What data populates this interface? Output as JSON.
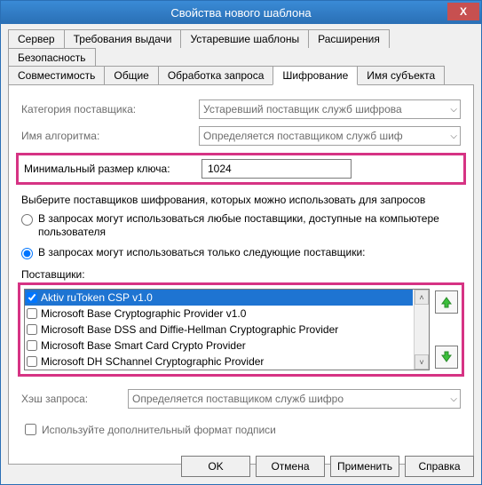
{
  "window": {
    "title": "Свойства нового шаблона",
    "close": "X"
  },
  "tabs_row1": [
    {
      "label": "Сервер"
    },
    {
      "label": "Требования выдачи"
    },
    {
      "label": "Устаревшие шаблоны"
    },
    {
      "label": "Расширения"
    },
    {
      "label": "Безопасность"
    }
  ],
  "tabs_row2": [
    {
      "label": "Совместимость"
    },
    {
      "label": "Общие"
    },
    {
      "label": "Обработка запроса"
    },
    {
      "label": "Шифрование"
    },
    {
      "label": "Имя субъекта"
    }
  ],
  "active_tab": "Шифрование",
  "fields": {
    "provider_category_label": "Категория поставщика:",
    "provider_category_value": "Устаревший поставщик служб шифрова",
    "algorithm_label": "Имя алгоритма:",
    "algorithm_value": "Определяется поставщиком служб шиф",
    "min_key_label": "Минимальный размер ключа:",
    "min_key_value": "1024",
    "choose_text": "Выберите поставщиков шифрования, которых можно использовать для запросов",
    "radio_any": "В запросах могут использоваться любые поставщики, доступные на компьютере пользователя",
    "radio_only": "В запросах могут использоваться только следующие поставщики:",
    "providers_label": "Поставщики:",
    "providers": [
      {
        "name": "Aktiv ruToken CSP v1.0",
        "checked": true,
        "selected": true
      },
      {
        "name": "Microsoft Base Cryptographic Provider v1.0",
        "checked": false
      },
      {
        "name": "Microsoft Base DSS and Diffie-Hellman Cryptographic Provider",
        "checked": false
      },
      {
        "name": "Microsoft Base Smart Card Crypto Provider",
        "checked": false
      },
      {
        "name": "Microsoft DH SChannel Cryptographic Provider",
        "checked": false
      }
    ],
    "hash_label": "Хэш запроса:",
    "hash_value": "Определяется поставщиком служб шифро",
    "sig_checkbox_label": "Используйте дополнительный формат подписи"
  },
  "buttons": {
    "ok": "OK",
    "cancel": "Отмена",
    "apply": "Применить",
    "help": "Справка"
  }
}
